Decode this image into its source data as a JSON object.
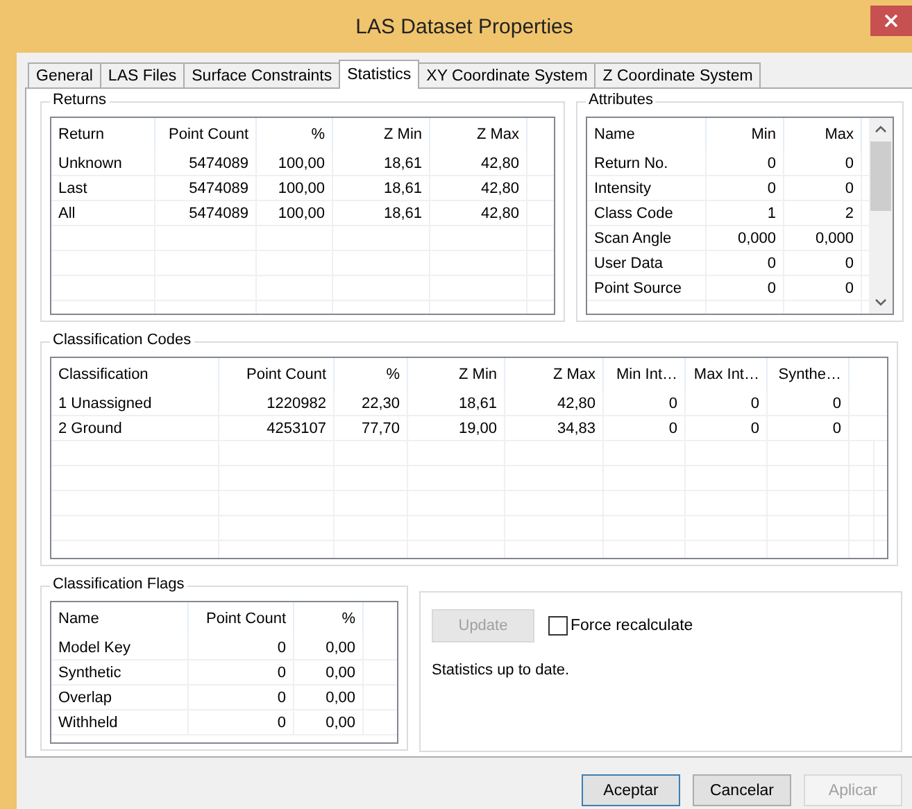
{
  "window": {
    "title": "LAS Dataset Properties"
  },
  "tabs": [
    {
      "label": "General",
      "selected": false
    },
    {
      "label": "LAS Files",
      "selected": false
    },
    {
      "label": "Surface Constraints",
      "selected": false
    },
    {
      "label": "Statistics",
      "selected": true
    },
    {
      "label": "XY Coordinate System",
      "selected": false
    },
    {
      "label": "Z Coordinate System",
      "selected": false
    }
  ],
  "returns": {
    "title": "Returns",
    "columns": [
      "Return",
      "Point Count",
      "%",
      "Z Min",
      "Z Max"
    ],
    "rows": [
      [
        "Unknown",
        "5474089",
        "100,00",
        "18,61",
        "42,80"
      ],
      [
        "Last",
        "5474089",
        "100,00",
        "18,61",
        "42,80"
      ],
      [
        "All",
        "5474089",
        "100,00",
        "18,61",
        "42,80"
      ]
    ]
  },
  "attributes": {
    "title": "Attributes",
    "columns": [
      "Name",
      "Min",
      "Max"
    ],
    "rows": [
      [
        "Return No.",
        "0",
        "0"
      ],
      [
        "Intensity",
        "0",
        "0"
      ],
      [
        "Class Code",
        "1",
        "2"
      ],
      [
        "Scan Angle",
        "0,000",
        "0,000"
      ],
      [
        "User Data",
        "0",
        "0"
      ],
      [
        "Point Source",
        "0",
        "0"
      ]
    ]
  },
  "classification_codes": {
    "title": "Classification Codes",
    "columns": [
      "Classification",
      "Point Count",
      "%",
      "Z Min",
      "Z Max",
      "Min Int…",
      "Max Int…",
      "Synthe…"
    ],
    "rows": [
      [
        "1  Unassigned",
        "1220982",
        "22,30",
        "18,61",
        "42,80",
        "0",
        "0",
        "0"
      ],
      [
        "2  Ground",
        "4253107",
        "77,70",
        "19,00",
        "34,83",
        "0",
        "0",
        "0"
      ]
    ]
  },
  "classification_flags": {
    "title": "Classification Flags",
    "columns": [
      "Name",
      "Point Count",
      "%"
    ],
    "rows": [
      [
        "Model Key",
        "0",
        "0,00"
      ],
      [
        "Synthetic",
        "0",
        "0,00"
      ],
      [
        "Overlap",
        "0",
        "0,00"
      ],
      [
        "Withheld",
        "0",
        "0,00"
      ]
    ]
  },
  "update_button": {
    "label": "Update",
    "disabled": true
  },
  "force_recalculate": {
    "label": "Force recalculate",
    "checked": false
  },
  "status_text": "Statistics up to date.",
  "buttons": [
    {
      "label": "Aceptar",
      "disabled": false,
      "default": true
    },
    {
      "label": "Cancelar",
      "disabled": false,
      "default": false
    },
    {
      "label": "Aplicar",
      "disabled": true,
      "default": false
    }
  ]
}
